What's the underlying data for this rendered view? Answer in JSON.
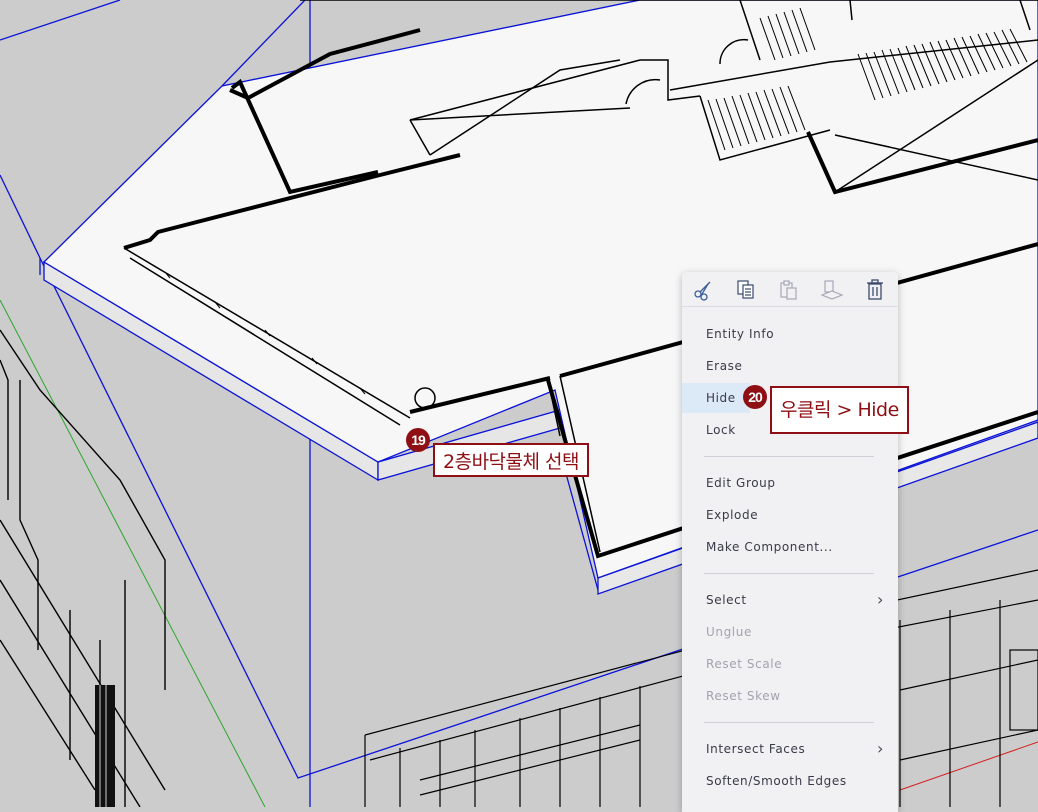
{
  "context_menu": {
    "toolbar": [
      {
        "icon": "cut-icon",
        "enabled": true
      },
      {
        "icon": "copy-icon",
        "enabled": true
      },
      {
        "icon": "paste-icon",
        "enabled": false
      },
      {
        "icon": "paste-in-place-icon",
        "enabled": false
      },
      {
        "icon": "delete-icon",
        "enabled": true
      }
    ],
    "items": [
      {
        "label": "Entity Info"
      },
      {
        "label": "Erase"
      },
      {
        "label": "Hide"
      },
      {
        "label": "Lock"
      },
      {
        "label": "Edit Group"
      },
      {
        "label": "Explode"
      },
      {
        "label": "Make Component..."
      },
      {
        "label": "Select"
      },
      {
        "label": "Unglue"
      },
      {
        "label": "Reset Scale"
      },
      {
        "label": "Reset Skew"
      },
      {
        "label": "Intersect Faces"
      },
      {
        "label": "Soften/Smooth Edges"
      }
    ],
    "hovered_item": "Hide",
    "disabled_items": [
      "Unglue",
      "Reset Scale",
      "Reset Skew"
    ]
  },
  "annotations": {
    "step19": {
      "number": "19",
      "text": "2층바닥물체 선택"
    },
    "step20": {
      "number": "20",
      "text": "우클릭 > Hide"
    }
  },
  "colors": {
    "background": "#cccccc",
    "selection_blue": "#0a12d8",
    "annotation_red": "#8e0f14",
    "menu_bg": "#f1f1f4",
    "menu_hover": "#dce9f7",
    "axis_green": "#2fa52f",
    "axis_red": "#d42020"
  }
}
